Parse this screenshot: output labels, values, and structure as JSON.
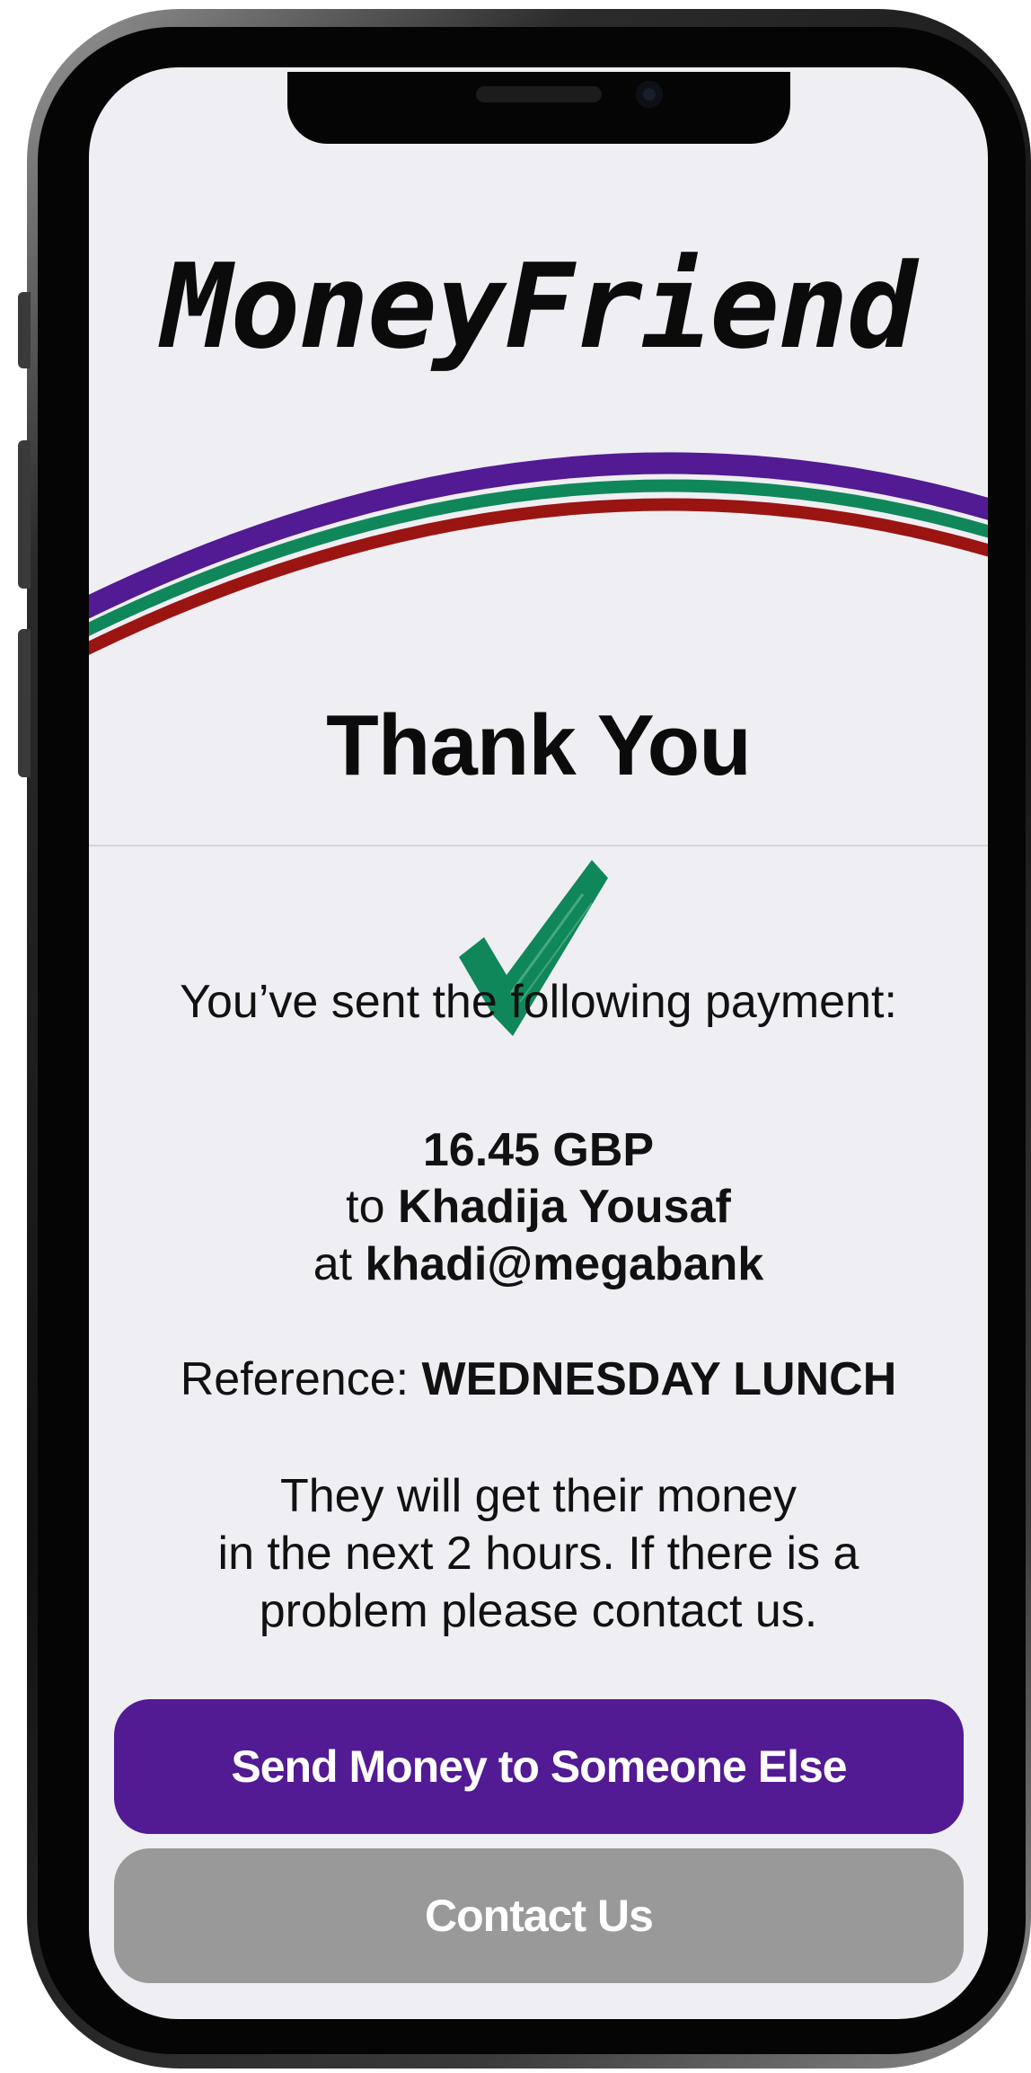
{
  "app": {
    "logo_text": "MoneyFriend",
    "accent_colors": {
      "purple": "#521a93",
      "green": "#10875a",
      "red": "#9a1512",
      "gray": "#999999"
    }
  },
  "confirmation": {
    "title": "Thank You",
    "intro": "You’ve sent the following payment:",
    "amount": "16.45 GBP",
    "to_prefix": "to ",
    "recipient_name": "Khadija Yousaf",
    "at_prefix": "at ",
    "recipient_handle": "khadi@megabank",
    "reference_label": "Reference: ",
    "reference_value": "WEDNESDAY LUNCH",
    "message_line1": "They will get their money",
    "message_line2": "in the next 2 hours. If there is a",
    "message_line3": "problem please contact us.",
    "icon": "check-mark-icon"
  },
  "actions": {
    "send_again_label": "Send Money to Someone Else",
    "contact_label": "Contact Us"
  }
}
